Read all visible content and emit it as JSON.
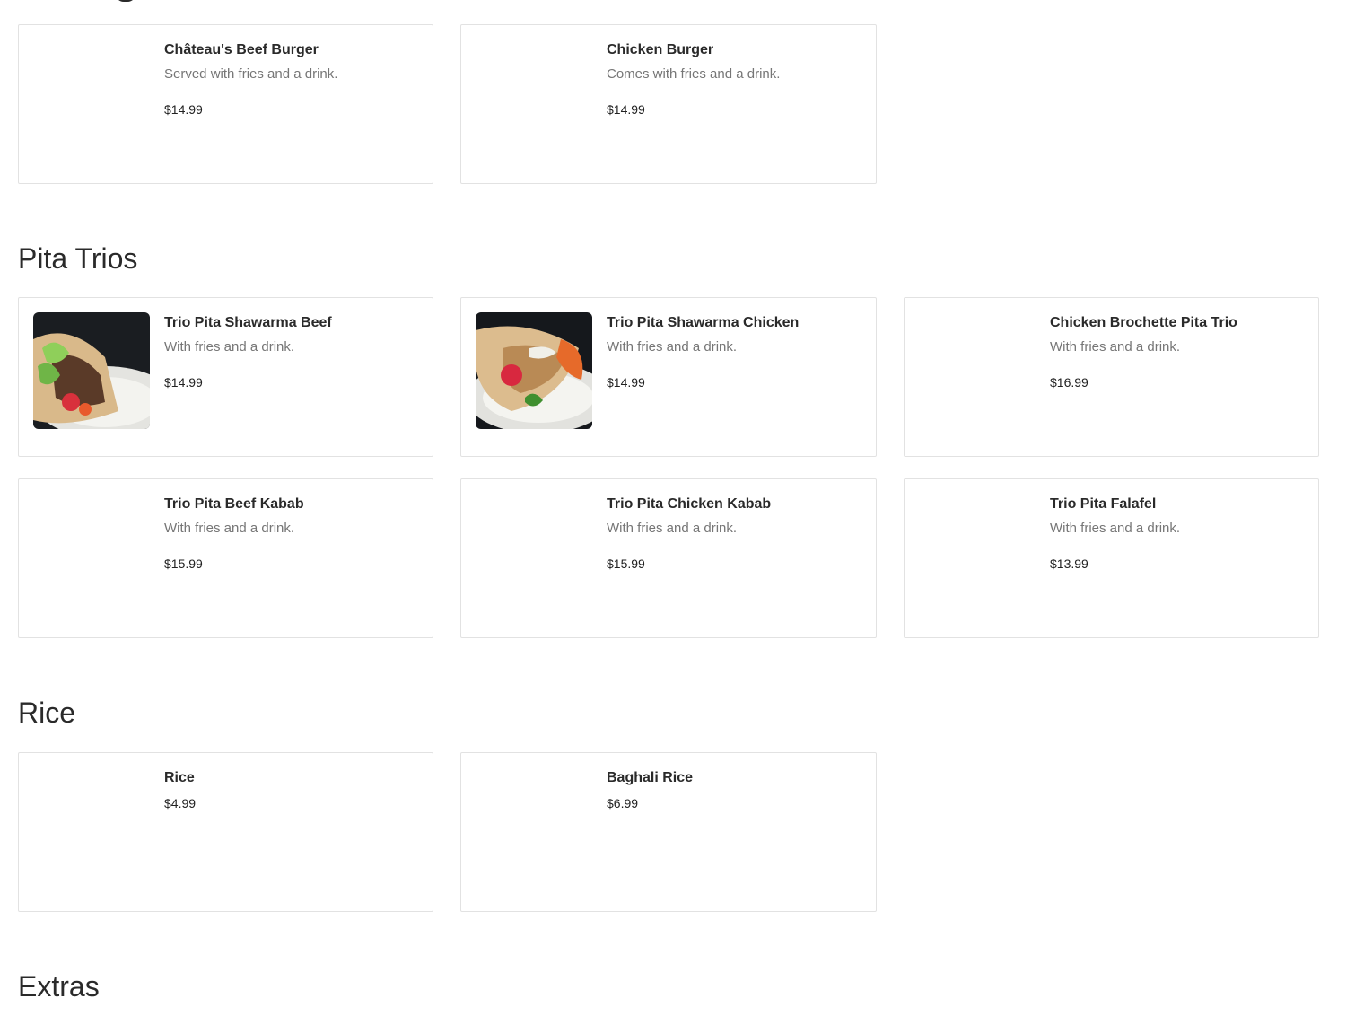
{
  "sections": {
    "top": {
      "items": [
        {
          "name": "Château's Beef Burger",
          "desc": "Served with fries and a drink.",
          "price": "$14.99"
        },
        {
          "name": "Chicken Burger",
          "desc": "Comes with fries and a drink.",
          "price": "$14.99"
        }
      ]
    },
    "pita_trios": {
      "title": "Pita Trios",
      "items": [
        {
          "name": "Trio Pita Shawarma Beef",
          "desc": "With fries and a drink.",
          "price": "$14.99"
        },
        {
          "name": "Trio Pita Shawarma Chicken",
          "desc": "With fries and a drink.",
          "price": "$14.99"
        },
        {
          "name": "Chicken Brochette Pita Trio",
          "desc": "With fries and a drink.",
          "price": "$16.99"
        },
        {
          "name": "Trio Pita Beef Kabab",
          "desc": "With fries and a drink.",
          "price": "$15.99"
        },
        {
          "name": "Trio Pita Chicken Kabab",
          "desc": "With fries and a drink.",
          "price": "$15.99"
        },
        {
          "name": "Trio Pita Falafel",
          "desc": "With fries and a drink.",
          "price": "$13.99"
        }
      ]
    },
    "rice": {
      "title": "Rice",
      "items": [
        {
          "name": "Rice",
          "price": "$4.99"
        },
        {
          "name": "Baghali Rice",
          "price": "$6.99"
        }
      ]
    },
    "extras": {
      "title": "Extras"
    }
  }
}
